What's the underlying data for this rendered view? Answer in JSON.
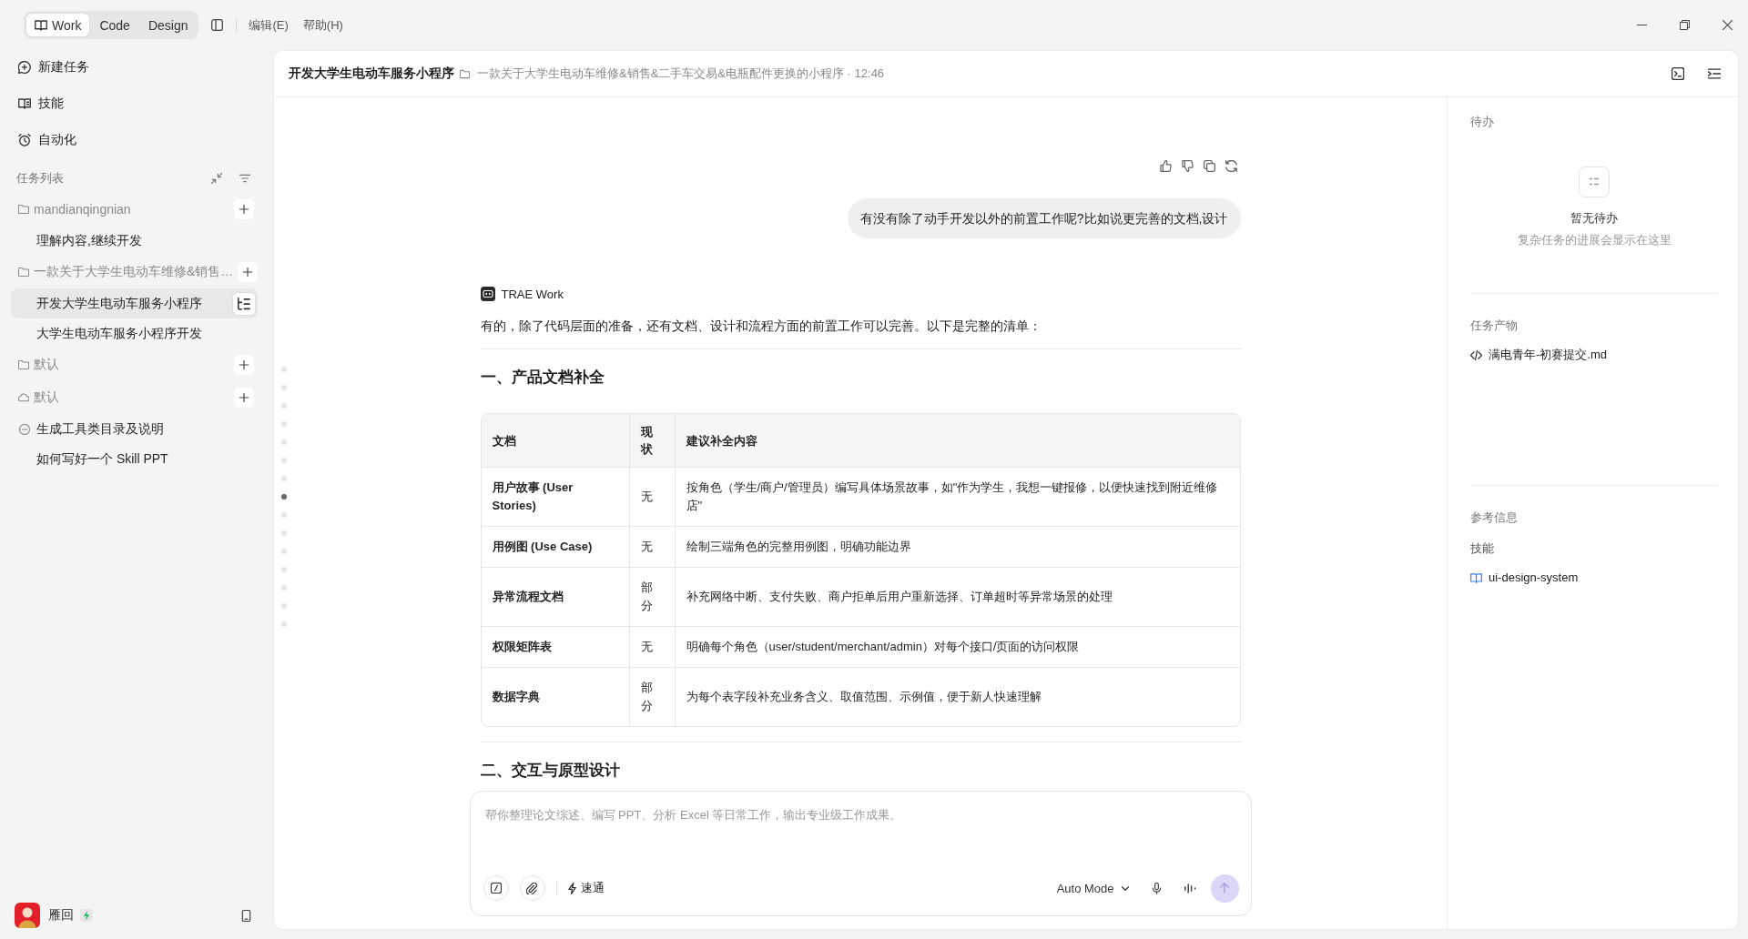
{
  "top_bar": {
    "modes": [
      {
        "label": "Work",
        "selected": true
      },
      {
        "label": "Code",
        "selected": false
      },
      {
        "label": "Design",
        "selected": false
      }
    ],
    "menus": [
      "编辑(E)",
      "帮助(H)"
    ]
  },
  "sidebar": {
    "nav": [
      {
        "label": "新建任务"
      },
      {
        "label": "技能"
      },
      {
        "label": "自动化"
      }
    ],
    "task_list": {
      "title": "任务列表",
      "groups": [
        {
          "kind": "folder",
          "name": "mandianqingnian",
          "children": [
            {
              "kind": "task",
              "label": "理解内容,继续开发",
              "selected": false
            }
          ]
        },
        {
          "kind": "folder",
          "name": "一款关于大学生电动车维修&销售…",
          "children": [
            {
              "kind": "task",
              "label": "开发大学生电动车服务小程序",
              "selected": true
            },
            {
              "kind": "task",
              "label": "大学生电动车服务小程序开发",
              "selected": false
            }
          ]
        },
        {
          "kind": "folder",
          "name": "默认"
        },
        {
          "kind": "cloud",
          "name": "默认",
          "children": [
            {
              "kind": "stopped",
              "label": "生成工具类目录及说明",
              "selected": false
            },
            {
              "kind": "task",
              "label": "如何写好一个 Skill PPT",
              "selected": false
            }
          ]
        }
      ]
    },
    "user": {
      "name": "雁回"
    }
  },
  "chat": {
    "header": {
      "title": "开发大学生电动车服务小程序",
      "subtitle": "一款关于大学生电动车维修&销售&二手车交易&电瓶配件更换的小程序 · 12:46"
    },
    "scroll_markers": [
      {
        "selected": false
      },
      {
        "selected": false
      },
      {
        "selected": false
      },
      {
        "selected": false
      },
      {
        "selected": false
      },
      {
        "selected": false
      },
      {
        "selected": false
      },
      {
        "selected": true
      },
      {
        "selected": false
      },
      {
        "selected": false
      },
      {
        "selected": false
      },
      {
        "selected": false
      },
      {
        "selected": false
      },
      {
        "selected": false
      },
      {
        "selected": false
      }
    ],
    "messages": [
      {
        "kind": "question",
        "text": "有没有除了动手开发以外的前置工作呢?比如说更完善的文档,设计"
      },
      {
        "kind": "answer",
        "author": "TRAE Work",
        "blocks": [
          {
            "kind": "paragraph",
            "text": "有的，除了代码层面的准备，还有文档、设计和流程方面的前置工作可以完善。以下是完整的清单："
          },
          {
            "kind": "rule"
          },
          {
            "kind": "heading",
            "text": "一、产品文档补全"
          },
          {
            "kind": "table",
            "columns": [
              "文档",
              "现状",
              "建议补全内容"
            ],
            "rows": [
              [
                "用户故事 (User Stories)",
                "无",
                "按角色（学生/商户/管理员）编写具体场景故事，如\"作为学生，我想一键报修，以便快速找到附近维修店\""
              ],
              [
                "用例图 (Use Case)",
                "无",
                "绘制三端角色的完整用例图，明确功能边界"
              ],
              [
                "异常流程文档",
                "部分",
                "补充网络中断、支付失败、商户拒单后用户重新选择、订单超时等异常场景的处理"
              ],
              [
                "权限矩阵表",
                "无",
                "明确每个角色（user/student/merchant/admin）对每个接口/页面的访问权限"
              ],
              [
                "数据字典",
                "部分",
                "为每个表字段补充业务含义、取值范围、示例值，便于新人快速理解"
              ]
            ]
          },
          {
            "kind": "rule"
          },
          {
            "kind": "heading",
            "text": "二、交互与原型设计"
          }
        ]
      }
    ],
    "input": {
      "placeholder": "帮你整理论文综述、编写 PPT、分析 Excel 等日常工作，输出专业级工作成果。",
      "mode": "速通",
      "model": "Auto Mode",
      "send_button": {
        "disabled": true
      }
    }
  },
  "right_panel": {
    "todo": {
      "title": "待办",
      "empty_title": "暂无待办",
      "empty_hint": "复杂任务的进展会显示在这里"
    },
    "artifacts": {
      "title": "任务产物",
      "items": [
        {
          "name": "满电青年-初赛提交.md"
        }
      ]
    },
    "references": {
      "title": "参考信息",
      "groups": [
        {
          "title": "技能",
          "items": [
            {
              "name": "ui-design-system"
            }
          ]
        }
      ]
    }
  }
}
